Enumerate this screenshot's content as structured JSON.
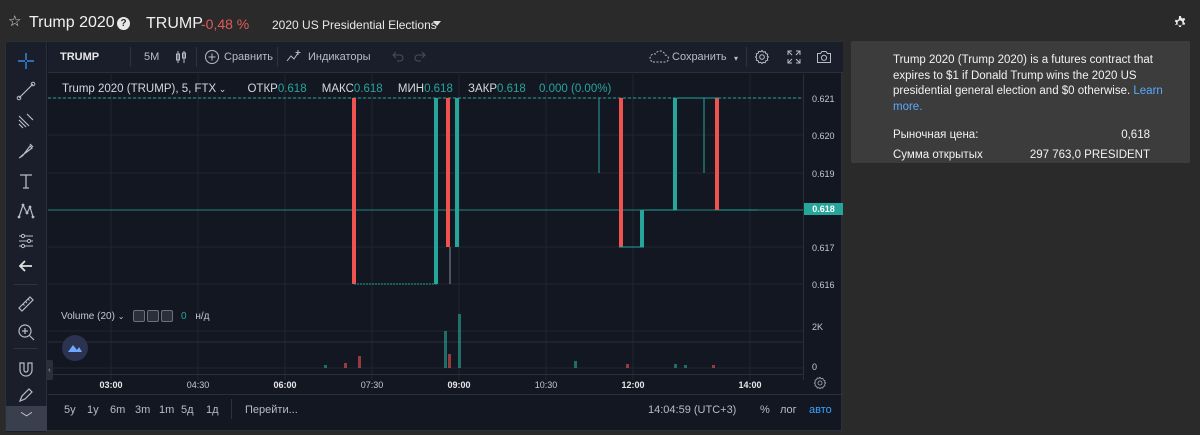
{
  "header": {
    "title": "Trump 2020",
    "ticker": "TRUMP",
    "change": "-0,48 %",
    "market": "2020 US Presidential Elections"
  },
  "toolbar": {
    "symbol": "TRUMP",
    "interval": "5M",
    "compare": "Сравнить",
    "indicators": "Индикаторы",
    "save": "Сохранить"
  },
  "legend": {
    "symbol": "Trump 2020 (TRUMP), 5, FTX",
    "open_label": "ОТКР",
    "open": "0.618",
    "high_label": "МАКС",
    "high": "0.618",
    "low_label": "МИН",
    "low": "0.618",
    "close_label": "ЗАКР",
    "close": "0.618",
    "change": "0.000 (0.00%)"
  },
  "volume": {
    "label": "Volume (20)",
    "value": "0",
    "na": "н/д"
  },
  "y_axis": [
    "0.621",
    "0.620",
    "0.619",
    "0.617",
    "0.616"
  ],
  "current_price": "0.618",
  "vol_axis": [
    "2K",
    "0"
  ],
  "x_axis": [
    "03:00",
    "04:30",
    "06:00",
    "07:30",
    "09:00",
    "10:30",
    "12:00",
    "14:00"
  ],
  "bottom": {
    "ranges": [
      "5y",
      "1y",
      "6m",
      "3m",
      "1m",
      "5д",
      "1д"
    ],
    "goto": "Перейти...",
    "time": "14:04:59 (UTC+3)",
    "percent": "%",
    "log": "лог",
    "auto": "авто"
  },
  "info": {
    "description": "Trump 2020 (Trump 2020) is a futures contract that expires to $1 if Donald Trump wins the 2020 US presidential general election and $0 otherwise.",
    "learn_more": "Learn more.",
    "market_price_label": "Рыночная цена:",
    "market_price": "0,618",
    "open_interest_label": "Сумма открытых",
    "open_interest": "297 763,0 PRESIDENT"
  },
  "colors": {
    "up": "#26a69a",
    "down": "#ef5350",
    "background": "#131722",
    "accent": "#3aa0ff"
  }
}
